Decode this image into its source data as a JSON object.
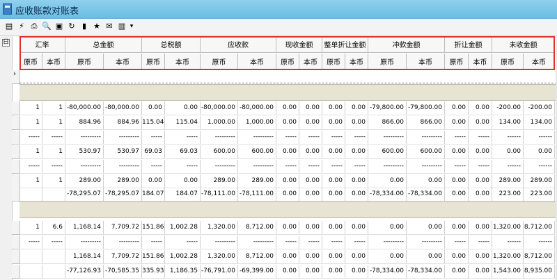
{
  "window": {
    "title": "应收账款对账表"
  },
  "toolbar": {
    "icons": [
      "column-setup",
      "filter",
      "print",
      "print-preview",
      "find",
      "refresh",
      "save",
      "favorite",
      "export",
      "expand"
    ],
    "dropdown_glyph": "▾"
  },
  "gutter": {
    "collapse_glyph": "日",
    "row_arrow": "›"
  },
  "header": {
    "groups": [
      "汇率",
      "总金额",
      "总税额",
      "应收款",
      "现收金额",
      "整单折让金额",
      "冲款金额",
      "折让金额",
      "未收金额"
    ],
    "sub": [
      "原币",
      "本币",
      "原币",
      "本币",
      "原币",
      "本币",
      "原币",
      "本币",
      "原币",
      "本币",
      "原币",
      "本币",
      "原币",
      "本币",
      "原币",
      "本币",
      "原币",
      "本币"
    ]
  },
  "rows": [
    [
      "1",
      "1",
      "-80,000.00",
      "-80,000.00",
      "0.00",
      "0.00",
      "-80,000.00",
      "-80,000.00",
      "0.00",
      "0.00",
      "0.00",
      "0.00",
      "-79,800.00",
      "-79,800.00",
      "0.00",
      "0.00",
      "-200.00",
      "-200.00"
    ],
    [
      "1",
      "1",
      "884.96",
      "884.96",
      "115.04",
      "115.04",
      "1,000.00",
      "1,000.00",
      "0.00",
      "0.00",
      "0.00",
      "0.00",
      "866.00",
      "866.00",
      "0.00",
      "0.00",
      "134.00",
      "134.00"
    ],
    [
      "-----",
      "-----",
      "---------",
      "---------",
      "-----",
      "-----",
      "---------",
      "---------",
      "-----",
      "-----",
      "-----",
      "-----",
      "---------",
      "---------",
      "-----",
      "-----",
      "------",
      "------"
    ],
    [
      "1",
      "1",
      "530.97",
      "530.97",
      "69.03",
      "69.03",
      "600.00",
      "600.00",
      "0.00",
      "0.00",
      "0.00",
      "0.00",
      "600.00",
      "600.00",
      "0.00",
      "0.00",
      "0.00",
      "0.00"
    ],
    [
      "-----",
      "-----",
      "---------",
      "---------",
      "-----",
      "-----",
      "---------",
      "---------",
      "-----",
      "-----",
      "-----",
      "-----",
      "---------",
      "---------",
      "-----",
      "-----",
      "------",
      "------"
    ],
    [
      "1",
      "1",
      "289.00",
      "289.00",
      "0.00",
      "0.00",
      "289.00",
      "289.00",
      "0.00",
      "0.00",
      "0.00",
      "0.00",
      "0.00",
      "0.00",
      "0.00",
      "0.00",
      "289.00",
      "289.00"
    ],
    [
      "",
      "",
      "-78,295.07",
      "-78,295.07",
      "184.07",
      "184.07",
      "-78,111.00",
      "-78,111.00",
      "0.00",
      "0.00",
      "0.00",
      "0.00",
      "-78,334.00",
      "-78,334.00",
      "0.00",
      "0.00",
      "223.00",
      "223.00"
    ],
    [
      "1",
      "6.6",
      "1,168.14",
      "7,709.72",
      "151.86",
      "1,002.28",
      "1,320.00",
      "8,712.00",
      "0.00",
      "0.00",
      "0.00",
      "0.00",
      "0.00",
      "0.00",
      "0.00",
      "0.00",
      "1,320.00",
      "8,712.00"
    ],
    [
      "-----",
      "-----",
      "---------",
      "---------",
      "-----",
      "-----",
      "---------",
      "---------",
      "-----",
      "-----",
      "-----",
      "-----",
      "---------",
      "---------",
      "-----",
      "-----",
      "------",
      "------"
    ],
    [
      "",
      "",
      "1,168.14",
      "7,709.72",
      "151.86",
      "1,002.28",
      "1,320.00",
      "8,712.00",
      "0.00",
      "0.00",
      "0.00",
      "0.00",
      "0.00",
      "0.00",
      "0.00",
      "0.00",
      "1,320.00",
      "8,712.00"
    ],
    [
      "",
      "",
      "-77,126.93",
      "-70,585.35",
      "335.93",
      "1,186.35",
      "-76,791.00",
      "-69,399.00",
      "0.00",
      "0.00",
      "0.00",
      "0.00",
      "-78,334.00",
      "-78,334.00",
      "0.00",
      "0.00",
      "1,543.00",
      "8,935.00"
    ]
  ]
}
